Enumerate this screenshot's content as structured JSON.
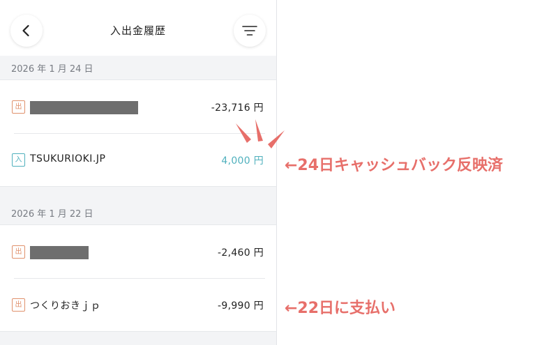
{
  "header": {
    "title": "入出金履歴",
    "back_icon": "chevron-left-icon",
    "filter_icon": "filter-icon"
  },
  "groups": [
    {
      "date": "2026 年 1 月 24 日",
      "transactions": [
        {
          "type_label": "出",
          "type": "out",
          "merchant": "",
          "redacted": true,
          "amount": "-23,716 円"
        },
        {
          "type_label": "入",
          "type": "in",
          "merchant": "TSUKURIOKI.JP",
          "redacted": false,
          "amount": "4,000 円"
        }
      ]
    },
    {
      "date": "2026 年 1 月 22 日",
      "transactions": [
        {
          "type_label": "出",
          "type": "out",
          "merchant": "",
          "redacted": true,
          "amount": "-2,460 円"
        },
        {
          "type_label": "出",
          "type": "out",
          "merchant": "つくりおきｊｐ",
          "redacted": false,
          "amount": "-9,990 円"
        }
      ]
    }
  ],
  "annotations": {
    "cashback": "←24日キャッシュバック反映済",
    "payment": "←22日に支払い"
  },
  "colors": {
    "out": "#e0916c",
    "in": "#4fb0bd",
    "annotation": "#e76f6a"
  }
}
